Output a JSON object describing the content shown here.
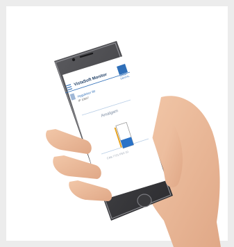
{
  "app": {
    "title": "VistaSoft Monitor",
    "logo_text": [
      "DÜRR",
      "DENTAL"
    ]
  },
  "device": {
    "name": "Hygobiser 90",
    "serial": "IP 10607"
  },
  "status": {
    "label": "Amalgam",
    "fill_fraction": 0.35,
    "footer": "CAS 7721 PS2 10"
  },
  "colors": {
    "accent": "#2f6fb8",
    "fill": "#2a72c7",
    "warning": "#e6a21f"
  },
  "icons": [
    "menu-icon",
    "device-icon",
    "container-icon"
  ]
}
